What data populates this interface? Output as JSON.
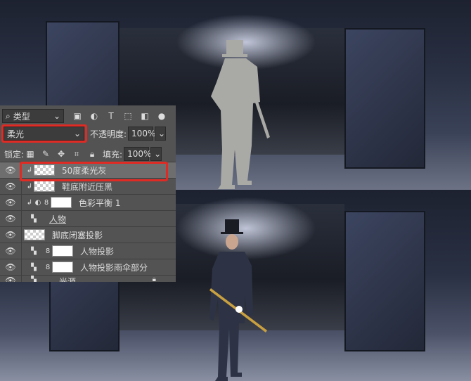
{
  "panel": {
    "filter_label": "类型",
    "blend_mode": "柔光",
    "opacity_label": "不透明度:",
    "opacity_value": "100%",
    "lock_label": "锁定:",
    "fill_label": "填充:",
    "fill_value": "100%",
    "layers": [
      {
        "name": "50度柔光灰",
        "clipped": true,
        "selected": true,
        "visible": true
      },
      {
        "name": "鞋底附近压黑",
        "clipped": true,
        "visible": true
      },
      {
        "name": "色彩平衡 1",
        "clipped": true,
        "visible": true
      },
      {
        "name": "人物",
        "visible": true
      },
      {
        "name": "脚底闭塞投影",
        "visible": true
      },
      {
        "name": "人物投影",
        "visible": true
      },
      {
        "name": "人物投影雨伞部分",
        "visible": true
      },
      {
        "name": "光源",
        "visible": true,
        "locked": true
      }
    ]
  },
  "colors": {
    "highlight": "#e02a24",
    "panel_bg": "#535353"
  }
}
